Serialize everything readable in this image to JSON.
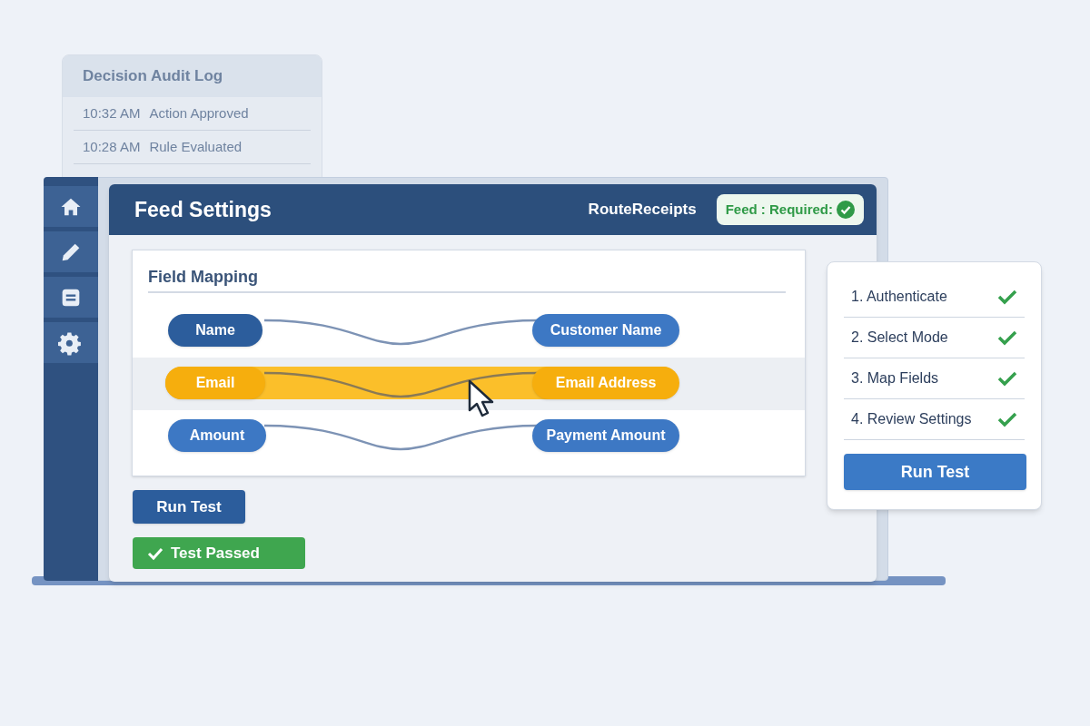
{
  "audit_log": {
    "title": "Decision Audit Log",
    "entries": [
      {
        "time": "10:32 AM",
        "event": "Action Approved"
      },
      {
        "time": "10:28 AM",
        "event": "Rule Evaluated"
      }
    ]
  },
  "window": {
    "title": "Feed Settings",
    "account": "RouteReceipts",
    "status_badge": {
      "label": "Feed : Required:",
      "ok": true
    }
  },
  "sidebar": {
    "items": [
      {
        "kind": "home"
      },
      {
        "kind": "edit"
      },
      {
        "kind": "list"
      },
      {
        "kind": "settings"
      }
    ]
  },
  "mapping": {
    "title": "Field Mapping",
    "rows": [
      {
        "source": "Name",
        "target": "Customer Name",
        "selected": false
      },
      {
        "source": "Email",
        "target": "Email Address",
        "selected": true
      },
      {
        "source": "Amount",
        "target": "Payment Amount",
        "selected": false
      }
    ]
  },
  "run_button": "Run Test",
  "result": {
    "label": "Test Passed",
    "passed": true
  },
  "steps": {
    "items": [
      {
        "label": "1. Authenticate",
        "done": true
      },
      {
        "label": "2. Select Mode",
        "done": true
      },
      {
        "label": "3. Map Fields",
        "done": true
      },
      {
        "label": "4. Review Settings",
        "done": true
      }
    ],
    "button": "Run Test"
  }
}
